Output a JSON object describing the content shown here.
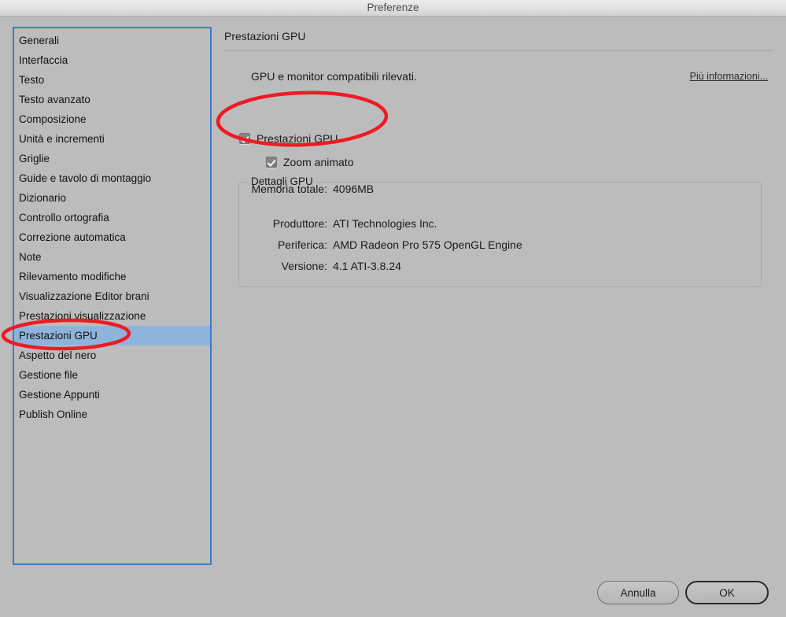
{
  "window": {
    "title": "Preferenze"
  },
  "sidebar": {
    "items": [
      {
        "label": "Generali",
        "selected": false
      },
      {
        "label": "Interfaccia",
        "selected": false
      },
      {
        "label": "Testo",
        "selected": false
      },
      {
        "label": "Testo avanzato",
        "selected": false
      },
      {
        "label": "Composizione",
        "selected": false
      },
      {
        "label": "Unità e incrementi",
        "selected": false
      },
      {
        "label": "Griglie",
        "selected": false
      },
      {
        "label": "Guide e tavolo di montaggio",
        "selected": false
      },
      {
        "label": "Dizionario",
        "selected": false
      },
      {
        "label": "Controllo ortografia",
        "selected": false
      },
      {
        "label": "Correzione automatica",
        "selected": false
      },
      {
        "label": "Note",
        "selected": false
      },
      {
        "label": "Rilevamento modifiche",
        "selected": false
      },
      {
        "label": "Visualizzazione Editor brani",
        "selected": false
      },
      {
        "label": "Prestazioni visualizzazione",
        "selected": false
      },
      {
        "label": "Prestazioni GPU",
        "selected": true
      },
      {
        "label": "Aspetto del nero",
        "selected": false
      },
      {
        "label": "Gestione file",
        "selected": false
      },
      {
        "label": "Gestione Appunti",
        "selected": false
      },
      {
        "label": "Publish Online",
        "selected": false
      }
    ]
  },
  "content": {
    "title": "Prestazioni GPU",
    "intro": "GPU e monitor compatibili rilevati.",
    "more_info_link": "Più informazioni...",
    "checkboxes": [
      {
        "label": "Prestazioni GPU",
        "checked": true
      },
      {
        "label": "Zoom animato",
        "checked": true
      }
    ],
    "group": {
      "legend": "Dettagli GPU",
      "rows": [
        {
          "label": "Produttore:",
          "value": "ATI Technologies Inc."
        },
        {
          "label": "Periferica:",
          "value": "AMD Radeon Pro 575 OpenGL Engine"
        },
        {
          "label": "Versione:",
          "value": "4.1 ATI-3.8.24"
        },
        {
          "label": "Memoria totale:",
          "value": "4096MB"
        }
      ]
    }
  },
  "footer": {
    "cancel_label": "Annulla",
    "ok_label": "OK"
  },
  "annotations": {
    "color": "#ee1b24",
    "shapes": [
      {
        "name": "checkbox-group-highlight"
      },
      {
        "name": "sidebar-selection-highlight"
      }
    ]
  },
  "colors": {
    "window_bg": "#bcbcbc",
    "selection_blue": "#8fb4dc",
    "focus_border": "#3b7bd0",
    "annotation_red": "#ee1b24"
  }
}
